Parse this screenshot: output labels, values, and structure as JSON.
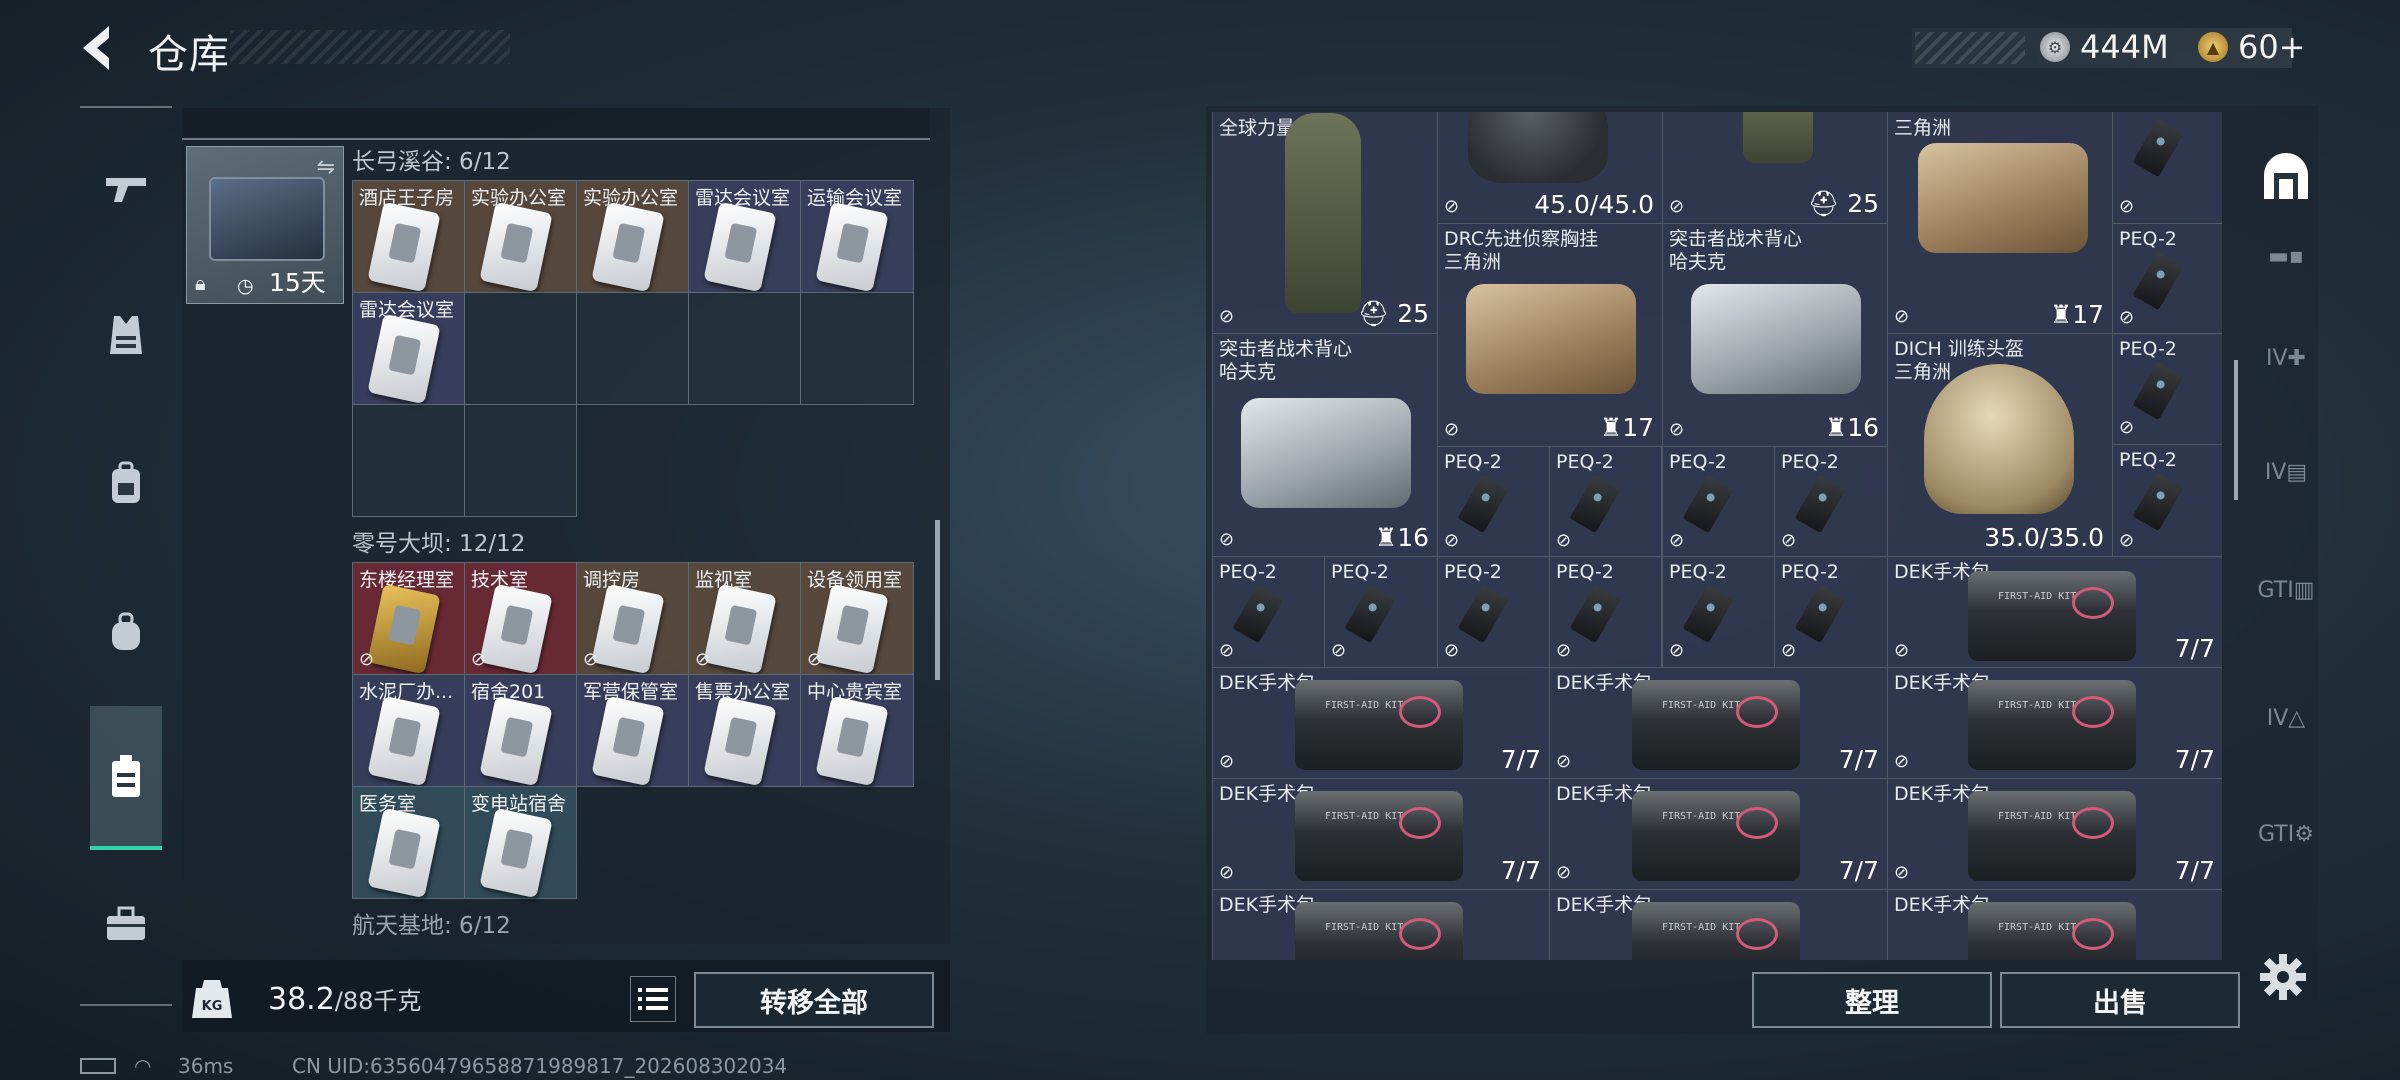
{
  "header": {
    "title": "仓库"
  },
  "currency": {
    "silver": "444M",
    "gold": "60+"
  },
  "stash": {
    "key_case_days": "15天",
    "sections": [
      {
        "label": "长弓溪谷: 6/12",
        "slots": [
          "酒店王子房",
          "实验办公室",
          "实验办公室",
          "雷达会议室",
          "运输会议室",
          "雷达会议室"
        ]
      },
      {
        "label": "零号大坝: 12/12",
        "slots": [
          "东楼经理室",
          "技术室",
          "调控房",
          "监视室",
          "设备领用室",
          "水泥厂办...",
          "宿舍201",
          "军营保管室",
          "售票办公室",
          "中心贵宾室",
          "医务室",
          "变电站宿舍"
        ]
      },
      {
        "label": "航天基地: 6/12"
      }
    ]
  },
  "weight": {
    "current": "38.2",
    "max": "/88千克",
    "icon_label": "KG"
  },
  "buttons": {
    "transfer_all": "转移全部",
    "organize": "整理",
    "sell": "出售"
  },
  "inventory": {
    "c1": "全球力量",
    "c2_count": "25",
    "helmet_top_dur": "45.0/45.0",
    "vest_top_count": "25",
    "top_right_name": "三角洲",
    "drc_name_1": "DRC先进侦察胸挂",
    "drc_name_2": "三角洲",
    "drc_count": "17",
    "raider_name_1": "突击者战术背心",
    "raider_name_2": "哈夫克",
    "raider_count": "16",
    "raider2_count": "16",
    "desert_top_count": "17",
    "dich_name_1": "DICH 训练头盔",
    "dich_name_2": "三角洲",
    "dich_dur": "35.0/35.0",
    "peq": "PEQ-2",
    "dek": "DEK手术包",
    "dek_count": "7/7"
  },
  "status": {
    "ping": "36ms",
    "uid": "CN UID:63560479658871989817_202608302034"
  },
  "colors": {
    "accent": "#2fd6a7",
    "cell_bg": "#323a52",
    "panel_bg": "#1c2630"
  }
}
